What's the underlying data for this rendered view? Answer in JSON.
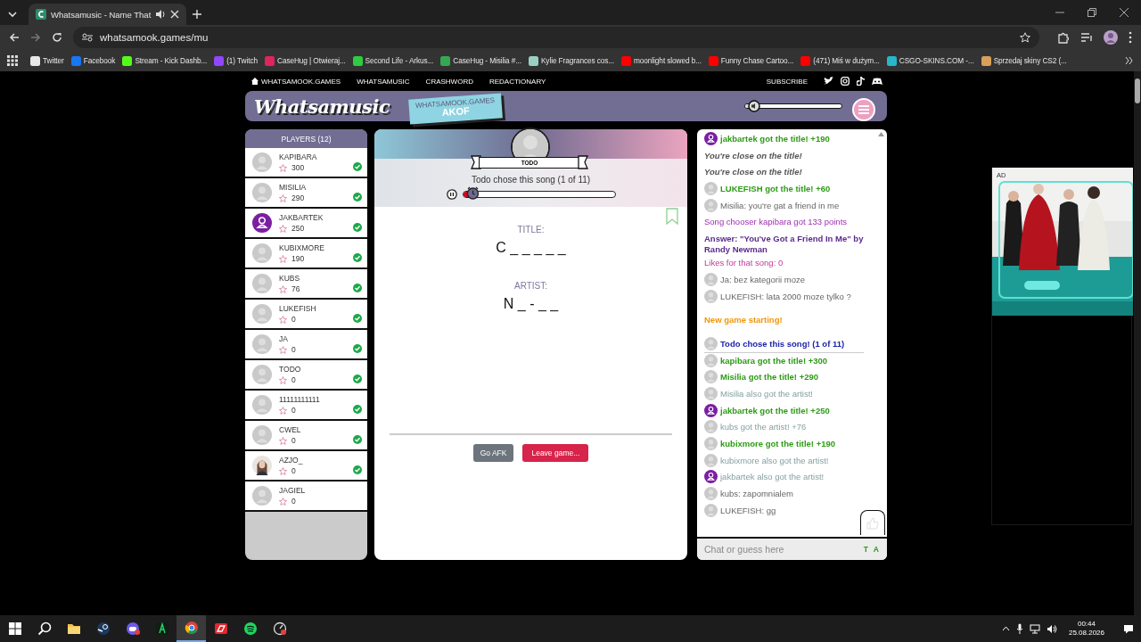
{
  "browser": {
    "tab": {
      "title": "Whatsamusic - Name That"
    },
    "address": "whatsamook.games/mu",
    "bookmarks": [
      {
        "label": "Twitter",
        "color": "#e8e8e8"
      },
      {
        "label": "Facebook",
        "color": "#1877f2"
      },
      {
        "label": "Stream - Kick Dashb...",
        "color": "#53fc18"
      },
      {
        "label": "(1) Twitch",
        "color": "#9146ff"
      },
      {
        "label": "CaseHug | Otwieraj...",
        "color": "#e0245e"
      },
      {
        "label": "Second Life - Arkus...",
        "color": "#2ecc40"
      },
      {
        "label": "CaseHug - Misilia #...",
        "color": "#34a853"
      },
      {
        "label": "Kylie Fragrances cos...",
        "color": "#9ad0c2"
      },
      {
        "label": "moonlight slowed b...",
        "color": "#ff0000"
      },
      {
        "label": "Funny Chase Cartoo...",
        "color": "#ff0000"
      },
      {
        "label": "(471) Miś w dużym...",
        "color": "#ff0000"
      },
      {
        "label": "CSGO-SKINS.COM -...",
        "color": "#29b6c9"
      },
      {
        "label": "Sprzedaj skiny CS2 (...",
        "color": "#d8a05a"
      }
    ]
  },
  "nav": {
    "links": [
      {
        "label": "WHATSAMOOK.GAMES",
        "kind": "home"
      },
      {
        "label": "WHATSAMUSIC",
        "kind": "link"
      },
      {
        "label": "CRASHWORD",
        "kind": "link"
      },
      {
        "label": "REDACTIONARY",
        "kind": "link"
      }
    ],
    "subscribe": "SUBSCRIBE"
  },
  "header": {
    "logo": "Whatsamusic",
    "ticket": {
      "site": "WHATSAMOOK.GAMES",
      "code": "AKOF"
    },
    "volume": {
      "level": 0.1
    }
  },
  "players": {
    "title": "PLAYERS (12)",
    "items": [
      {
        "name": "KAPIBARA",
        "score": "300",
        "ready": true,
        "kind": "guest"
      },
      {
        "name": "MISILIA",
        "score": "290",
        "ready": true,
        "kind": "guest"
      },
      {
        "name": "JAKBARTEK",
        "score": "250",
        "ready": true,
        "kind": "account"
      },
      {
        "name": "KUBIXMORE",
        "score": "190",
        "ready": true,
        "kind": "guest"
      },
      {
        "name": "KUBS",
        "score": "76",
        "ready": true,
        "kind": "guest"
      },
      {
        "name": "LUKEFISH",
        "score": "0",
        "ready": true,
        "kind": "guest"
      },
      {
        "name": "JA",
        "score": "0",
        "ready": true,
        "kind": "guest"
      },
      {
        "name": "TODO",
        "score": "0",
        "ready": true,
        "kind": "guest"
      },
      {
        "name": "11111111111",
        "score": "0",
        "ready": true,
        "kind": "guest"
      },
      {
        "name": "CWEL",
        "score": "0",
        "ready": true,
        "kind": "guest"
      },
      {
        "name": "AZJO_",
        "score": "0",
        "ready": true
      },
      {
        "name": "JAGIEL",
        "score": "0",
        "ready": false,
        "kind": "guest"
      }
    ]
  },
  "game": {
    "chooser": "TODO",
    "caption": "Todo chose this song (1 of 11)",
    "progress": {
      "level": 0.07
    },
    "bookmarked": false,
    "title_label": "TITLE:",
    "title_hint": "C _ _ _ _ _",
    "artist_label": "ARTIST:",
    "artist_hint": "N _ - _ _",
    "buttons": [
      {
        "label": "Go AFK",
        "kind": "neutral"
      },
      {
        "label": "Leave game...",
        "kind": "danger"
      }
    ]
  },
  "chat": {
    "messages": [
      {
        "text": "jakbartek got the title! +190",
        "kind": "title",
        "avatar": true,
        "account": true
      },
      {
        "text": "You're close on the title!",
        "kind": "close"
      },
      {
        "text": "You're close on the title!",
        "kind": "close"
      },
      {
        "text": "LUKEFISH got the title! +60",
        "kind": "title",
        "avatar": true,
        "account": false
      },
      {
        "text": "Misilia: you're gat a friend in me",
        "kind": "chat",
        "avatar": true,
        "account": false
      },
      {
        "text": "Song chooser kapibara got 133 points",
        "kind": "chooser"
      },
      {
        "text": "Answer: \"You've Got a Friend In Me\" by Randy Newman",
        "kind": "answer"
      },
      {
        "text": "Likes for that song: 0",
        "kind": "likes"
      },
      {
        "text": "Ja: bez kategorii moze",
        "kind": "chat",
        "avatar": true,
        "account": false
      },
      {
        "text": "LUKEFISH: lata 2000 moze tylko ?",
        "kind": "chat",
        "avatar": true,
        "account": false
      },
      {
        "text": "New game starting!",
        "kind": "newgame"
      },
      {
        "text": "Todo chose this song! (1 of 11)",
        "kind": "song",
        "avatar": true,
        "account": false
      },
      {
        "text": "kapibara got the title! +300",
        "kind": "title",
        "avatar": true,
        "account": false
      },
      {
        "text": "Misilia got the title! +290",
        "kind": "title",
        "avatar": true,
        "account": false
      },
      {
        "text": "Misilia also got the artist!",
        "kind": "artist",
        "avatar": true,
        "account": false
      },
      {
        "text": "jakbartek got the title! +250",
        "kind": "title",
        "avatar": true,
        "account": true
      },
      {
        "text": "kubs got the artist! +76",
        "kind": "artist",
        "avatar": true,
        "account": false
      },
      {
        "text": "kubixmore got the title! +190",
        "kind": "title",
        "avatar": true,
        "account": false
      },
      {
        "text": "kubixmore also got the artist!",
        "kind": "artist",
        "avatar": true,
        "account": false
      },
      {
        "text": "jakbartek also got the artist!",
        "kind": "artist",
        "avatar": true,
        "account": true
      },
      {
        "text": "kubs: zapomnialem",
        "kind": "chat",
        "avatar": true,
        "account": false
      },
      {
        "text": "LUKEFISH: gg",
        "kind": "chat",
        "avatar": true,
        "account": false
      }
    ],
    "input": {
      "placeholder": "Chat or guess here"
    },
    "tools": [
      "T",
      "A"
    ]
  },
  "ad": {
    "label": "AD",
    "kind": "picture"
  },
  "taskbar": {
    "time": "00:44",
    "date": "25.08.2026"
  }
}
